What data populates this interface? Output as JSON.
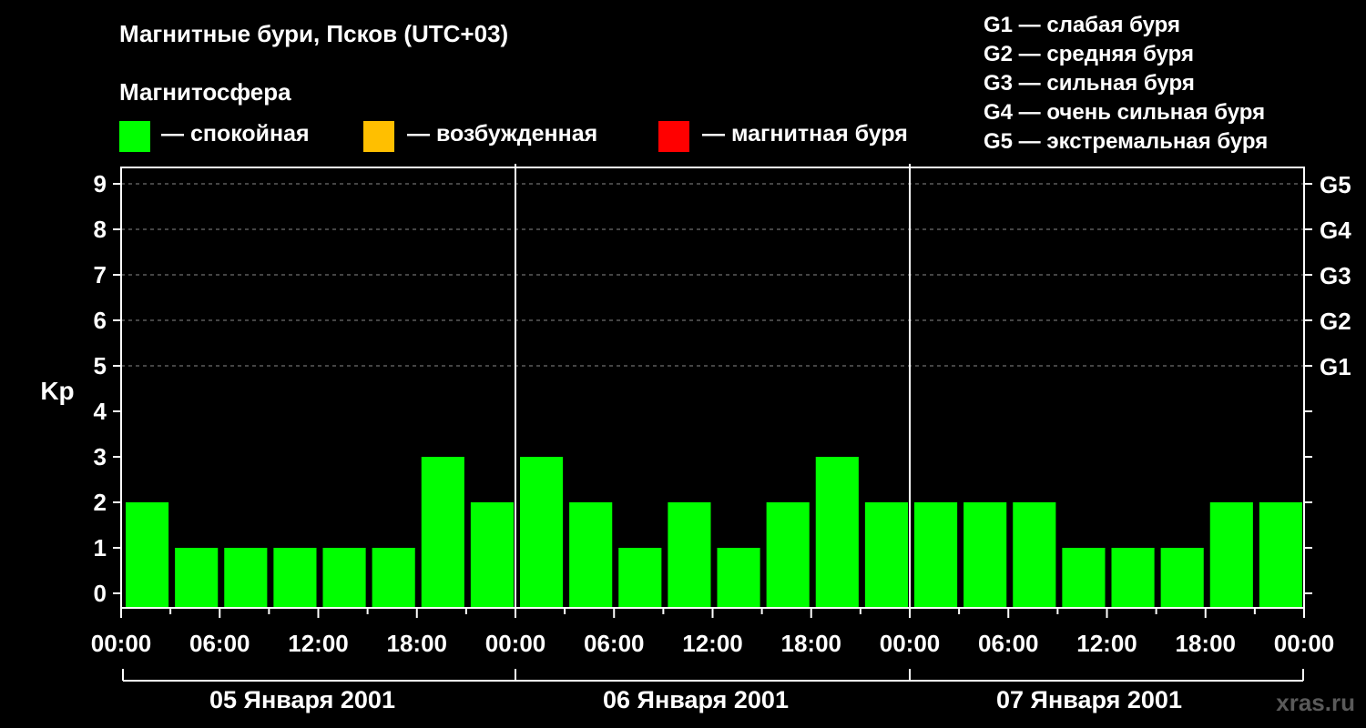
{
  "title": "Магнитные бури, Псков (UTC+03)",
  "subtitle": "Магнитосфера",
  "legend": [
    {
      "label": "— спокойная",
      "color": "#00ff00"
    },
    {
      "label": "— возбужденная",
      "color": "#ffbf00"
    },
    {
      "label": "— магнитная буря",
      "color": "#ff0000"
    }
  ],
  "g_scale": [
    "G1 — слабая буря",
    "G2 — средняя буря",
    "G3 — сильная буря",
    "G4 — очень сильная буря",
    "G5 — экстремальная буря"
  ],
  "watermark": "xras.ru",
  "chart_data": {
    "type": "bar",
    "ylabel": "Kp",
    "ylim": [
      0,
      9
    ],
    "yticks": [
      "0",
      "1",
      "2",
      "3",
      "4",
      "5",
      "6",
      "7",
      "8",
      "9"
    ],
    "right_ticks": [
      {
        "y": 5,
        "label": "G1"
      },
      {
        "y": 6,
        "label": "G2"
      },
      {
        "y": 7,
        "label": "G3"
      },
      {
        "y": 8,
        "label": "G4"
      },
      {
        "y": 9,
        "label": "G5"
      }
    ],
    "xtick_labels": [
      "00:00",
      "06:00",
      "12:00",
      "18:00",
      "00:00",
      "06:00",
      "12:00",
      "18:00",
      "00:00",
      "06:00",
      "12:00",
      "18:00",
      "00:00"
    ],
    "days": [
      "05 Января 2001",
      "06 Января 2001",
      "07 Января 2001"
    ],
    "grid": "dashed horizontal at 5-9",
    "series": [
      {
        "values": [
          2,
          1,
          1,
          1,
          1,
          1,
          3,
          2,
          3,
          2,
          1,
          2,
          1,
          2,
          3,
          2,
          2,
          2,
          2,
          1,
          1,
          1,
          2,
          2
        ],
        "color": "#00ff00"
      }
    ]
  }
}
